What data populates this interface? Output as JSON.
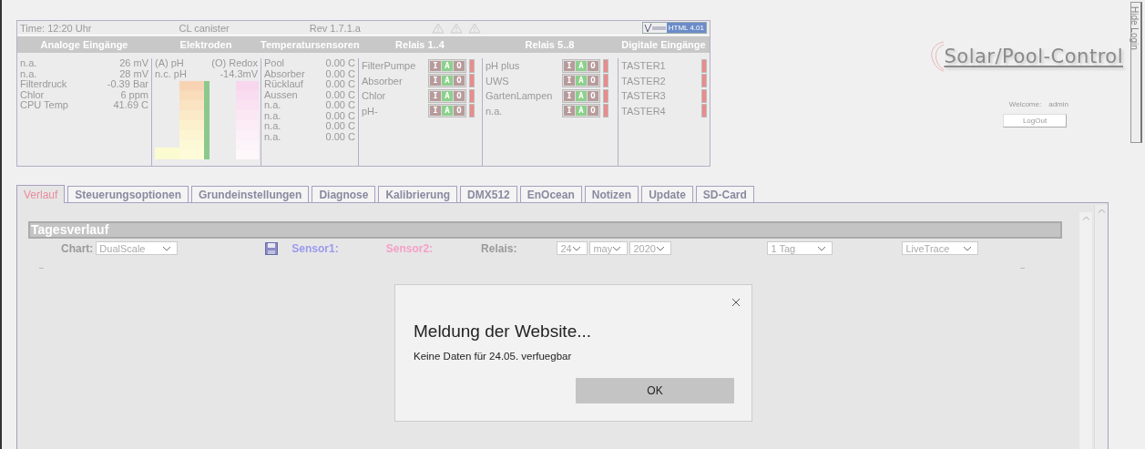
{
  "status": {
    "time": "Time: 12:20 Uhr",
    "device": "CL canister",
    "revision": "Rev 1.7.1.a",
    "badge": "HTML 4.01",
    "headers": [
      "Analoge Eingänge",
      "Elektroden",
      "Temperatursensoren",
      "Relais 1..4",
      "Relais 5..8",
      "Digitale Eingänge"
    ],
    "analog": [
      {
        "label": "n.a.",
        "value": "26 mV"
      },
      {
        "label": "n.a.",
        "value": "28 mV"
      },
      {
        "label": "Filterdruck",
        "value": "-0.39 Bar"
      },
      {
        "label": "Chlor",
        "value": "6 ppm"
      },
      {
        "label": "CPU Temp",
        "value": "41.69 C"
      }
    ],
    "electrodes": {
      "ph_label": "(A) pH",
      "redox_label": "(O) Redox",
      "ph_value": "n.c. pH",
      "redox_value": "-14.3mV"
    },
    "temperatures": [
      {
        "label": "Pool",
        "value": "0.00 C"
      },
      {
        "label": "Absorber",
        "value": "0.00 C"
      },
      {
        "label": "Rücklauf",
        "value": "0.00 C"
      },
      {
        "label": "Aussen",
        "value": "0.00 C"
      },
      {
        "label": "n.a.",
        "value": "0.00 C"
      },
      {
        "label": "n.a.",
        "value": "0.00 C"
      },
      {
        "label": "n.a.",
        "value": "0.00 C"
      },
      {
        "label": "n.a.",
        "value": "0.00 C"
      }
    ],
    "relays_1_4": [
      {
        "label": "FilterPumpe",
        "modes": [
          {
            "label": "I",
            "selected": false
          },
          {
            "label": "A",
            "selected": true
          },
          {
            "label": "O",
            "selected": false
          }
        ],
        "on": false
      },
      {
        "label": "Absorber",
        "modes": [
          {
            "label": "I",
            "selected": false
          },
          {
            "label": "A",
            "selected": true
          },
          {
            "label": "O",
            "selected": false
          }
        ],
        "on": false
      },
      {
        "label": "Chlor",
        "modes": [
          {
            "label": "I",
            "selected": false
          },
          {
            "label": "A",
            "selected": true
          },
          {
            "label": "O",
            "selected": false
          }
        ],
        "on": false
      },
      {
        "label": "pH-",
        "modes": [
          {
            "label": "I",
            "selected": false
          },
          {
            "label": "A",
            "selected": true
          },
          {
            "label": "O",
            "selected": false
          }
        ],
        "on": false
      }
    ],
    "relays_5_8": [
      {
        "label": "pH plus",
        "modes": [
          {
            "label": "I",
            "selected": false
          },
          {
            "label": "A",
            "selected": true
          },
          {
            "label": "O",
            "selected": false
          }
        ],
        "on": false
      },
      {
        "label": "UWS",
        "modes": [
          {
            "label": "I",
            "selected": false
          },
          {
            "label": "A",
            "selected": true
          },
          {
            "label": "O",
            "selected": false
          }
        ],
        "on": false
      },
      {
        "label": "GartenLampen",
        "modes": [
          {
            "label": "I",
            "selected": false
          },
          {
            "label": "A",
            "selected": true
          },
          {
            "label": "O",
            "selected": false
          }
        ],
        "on": false
      },
      {
        "label": "n.a.",
        "modes": [
          {
            "label": "I",
            "selected": false
          },
          {
            "label": "A",
            "selected": true
          },
          {
            "label": "O",
            "selected": false
          }
        ],
        "on": false
      }
    ],
    "digital_inputs": [
      {
        "label": "TASTER1",
        "on": false
      },
      {
        "label": "TASTER2",
        "on": false
      },
      {
        "label": "TASTER3",
        "on": false
      },
      {
        "label": "TASTER4",
        "on": false
      }
    ]
  },
  "logo": "Solar/Pool-Control",
  "login": {
    "welcome": "Welcome:",
    "user": "admin",
    "button": "LogOut",
    "side_tab": "Hide Login"
  },
  "tabs": [
    {
      "label": "Verlauf",
      "selected": true
    },
    {
      "label": "Steuerungsoptionen",
      "selected": false
    },
    {
      "label": "Grundeinstellungen",
      "selected": false
    },
    {
      "label": "Diagnose",
      "selected": false
    },
    {
      "label": "Kalibrierung",
      "selected": false
    },
    {
      "label": "DMX512",
      "selected": false
    },
    {
      "label": "EnOcean",
      "selected": false
    },
    {
      "label": "Notizen",
      "selected": false
    },
    {
      "label": "Update",
      "selected": false
    },
    {
      "label": "SD-Card",
      "selected": false
    }
  ],
  "chart_panel": {
    "title": "Tagesverlauf",
    "chart_label": "Chart:",
    "chart_type": "DualScale",
    "sensor1": "Sensor1:",
    "sensor2": "Sensor2:",
    "relais": "Relais:",
    "day": "24",
    "month": "may",
    "year": "2020",
    "range": "1 Tag",
    "mode": "LiveTrace",
    "left_mark": "–",
    "right_mark": "–"
  },
  "dialog": {
    "title": "Meldung der Website...",
    "message": "Keine Daten für 24.05. verfuegbar",
    "button": "OK"
  }
}
